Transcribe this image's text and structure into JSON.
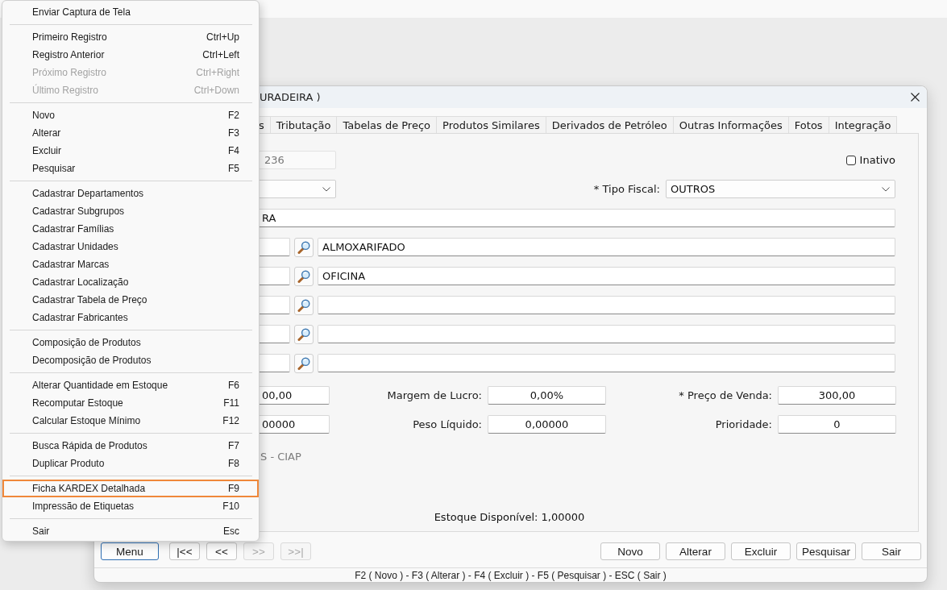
{
  "window": {
    "title": "URADEIRA )"
  },
  "tabs": [
    {
      "label": "s",
      "selected": false
    },
    {
      "label": "Tributação",
      "selected": false
    },
    {
      "label": "Tabelas de Preço",
      "selected": false
    },
    {
      "label": "Produtos Similares",
      "selected": false
    },
    {
      "label": "Derivados de Petróleo",
      "selected": false
    },
    {
      "label": "Outras Informações",
      "selected": false
    },
    {
      "label": "Fotos",
      "selected": false
    },
    {
      "label": "Integração",
      "selected": false
    }
  ],
  "form": {
    "code": {
      "value": "236",
      "disabled": true
    },
    "inactive": {
      "label": "Inativo",
      "checked": false
    },
    "fiscal_type": {
      "label": "* Tipo Fiscal:",
      "value": "OUTROS"
    },
    "description": {
      "value": "RA"
    },
    "lookup_rows": [
      {
        "name": "ALMOXARIFADO"
      },
      {
        "name": "OFICINA"
      },
      {},
      {},
      {}
    ],
    "value_rows": [
      {
        "first_value": "00,00",
        "fields": [
          {
            "label": "Margem de Lucro:",
            "value": "0,00%"
          },
          {
            "label": "* Preço de Venda:",
            "value": "300,00"
          }
        ]
      },
      {
        "first_value": "00000",
        "fields": [
          {
            "label": "Peso Líquido:",
            "value": "0,00000"
          },
          {
            "label": "Prioridade:",
            "value": "0"
          }
        ]
      }
    ],
    "ciap": {
      "text": "S - CIAP",
      "disabled": true
    },
    "stock": "Estoque Disponível: 1,00000"
  },
  "nav_buttons": [
    {
      "label": "Menu",
      "focused": true,
      "disabled": false
    },
    {
      "label": "|<<",
      "focused": false,
      "disabled": false
    },
    {
      "label": "<<",
      "focused": false,
      "disabled": false
    },
    {
      "label": ">>",
      "focused": false,
      "disabled": true
    },
    {
      "label": ">>|",
      "focused": false,
      "disabled": true
    }
  ],
  "action_buttons": [
    "Novo",
    "Alterar",
    "Excluir",
    "Pesquisar",
    "Sair"
  ],
  "status_bar": "F2 ( Novo ) - F3 ( Alterar ) - F4 ( Excluir ) - F5 ( Pesquisar ) - ESC ( Sair )",
  "context_menu": {
    "groups": [
      [
        {
          "label": "Enviar Captura de Tela",
          "disabled": false,
          "selected": false
        }
      ],
      [
        {
          "label": "Primeiro Registro",
          "shortcut": "Ctrl+Up",
          "disabled": false,
          "selected": false
        },
        {
          "label": "Registro Anterior",
          "shortcut": "Ctrl+Left",
          "disabled": false,
          "selected": false
        },
        {
          "label": "Próximo Registro",
          "shortcut": "Ctrl+Right",
          "disabled": true,
          "selected": false
        },
        {
          "label": "Último Registro",
          "shortcut": "Ctrl+Down",
          "disabled": true,
          "selected": false
        }
      ],
      [
        {
          "label": "Novo",
          "shortcut": "F2",
          "disabled": false,
          "selected": false
        },
        {
          "label": "Alterar",
          "shortcut": "F3",
          "disabled": false,
          "selected": false
        },
        {
          "label": "Excluir",
          "shortcut": "F4",
          "disabled": false,
          "selected": false
        },
        {
          "label": "Pesquisar",
          "shortcut": "F5",
          "disabled": false,
          "selected": false
        }
      ],
      [
        {
          "label": "Cadastrar Departamentos",
          "disabled": false,
          "selected": false
        },
        {
          "label": "Cadastrar Subgrupos",
          "disabled": false,
          "selected": false
        },
        {
          "label": "Cadastrar Famílias",
          "disabled": false,
          "selected": false
        },
        {
          "label": "Cadastrar Unidades",
          "disabled": false,
          "selected": false
        },
        {
          "label": "Cadastrar Marcas",
          "disabled": false,
          "selected": false
        },
        {
          "label": "Cadastrar Localização",
          "disabled": false,
          "selected": false
        },
        {
          "label": "Cadastrar Tabela de Preço",
          "disabled": false,
          "selected": false
        },
        {
          "label": "Cadastrar Fabricantes",
          "disabled": false,
          "selected": false
        }
      ],
      [
        {
          "label": "Composição de Produtos",
          "disabled": false,
          "selected": false
        },
        {
          "label": "Decomposição de Produtos",
          "disabled": false,
          "selected": false
        }
      ],
      [
        {
          "label": "Alterar Quantidade em Estoque",
          "shortcut": "F6",
          "disabled": false,
          "selected": false
        },
        {
          "label": "Recomputar Estoque",
          "shortcut": "F11",
          "disabled": false,
          "selected": false
        },
        {
          "label": "Calcular Estoque Mínimo",
          "shortcut": "F12",
          "disabled": false,
          "selected": false
        }
      ],
      [
        {
          "label": "Busca Rápida de Produtos",
          "shortcut": "F7",
          "disabled": false,
          "selected": false
        },
        {
          "label": "Duplicar Produto",
          "shortcut": "F8",
          "disabled": false,
          "selected": false
        }
      ],
      [
        {
          "label": "Ficha KARDEX Detalhada",
          "shortcut": "F9",
          "disabled": false,
          "selected": true
        },
        {
          "label": "Impressão de Etiquetas",
          "shortcut": "F10",
          "disabled": false,
          "selected": false
        }
      ],
      [
        {
          "label": "Sair",
          "shortcut": "Esc",
          "disabled": false,
          "selected": false
        }
      ]
    ]
  }
}
